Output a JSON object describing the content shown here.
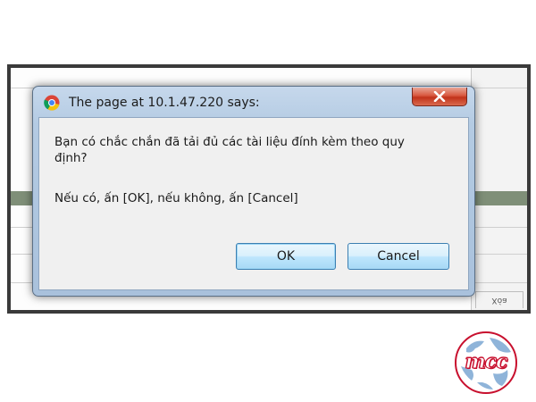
{
  "dialog": {
    "title": "The page at 10.1.47.220 says:",
    "message_line1": "Bạn có chắc chắn đã tải đủ các tài liệu đính kèm theo quy định?",
    "message_line2": "Nếu có, ấn [OK], nếu không, ấn [Cancel]",
    "ok_label": "OK",
    "cancel_label": "Cancel",
    "close_icon": "close-icon",
    "app_icon": "chrome-icon"
  },
  "background": {
    "cell_text": "Xóa"
  },
  "logo": {
    "text": "mcc",
    "colors": {
      "brand": "#c8102e",
      "globe": "#8fb4d9"
    }
  },
  "colors": {
    "frame": "#3a3a3a",
    "band": "#7f8f78",
    "dialog_frame": "#b4cbe3",
    "close_button": "#c1321a"
  }
}
